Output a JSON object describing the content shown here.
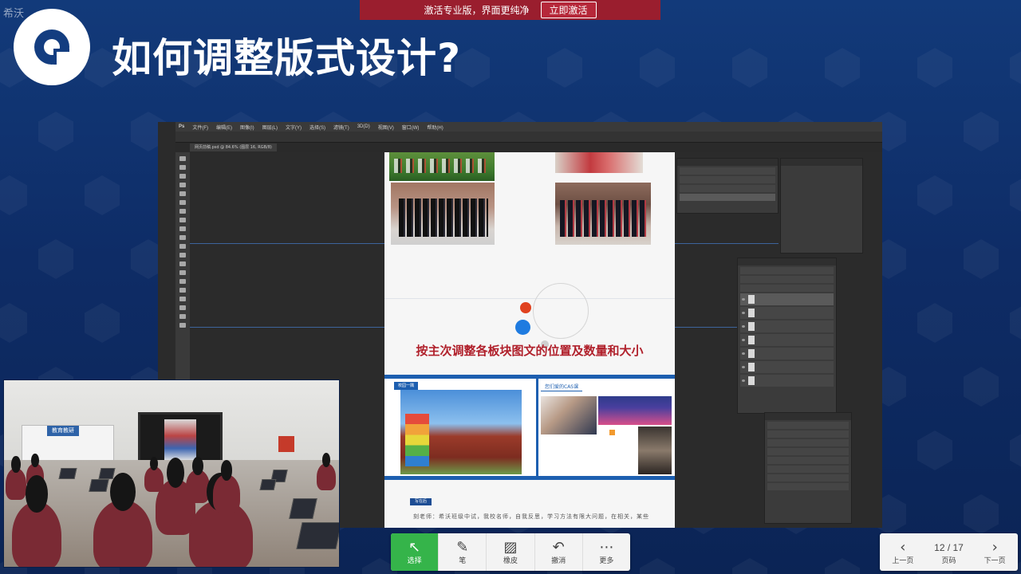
{
  "watermark": "希沃",
  "banner": {
    "text": "激活专业版，界面更纯净",
    "button": "立即激活"
  },
  "slide": {
    "title": "如何调整版式设计?"
  },
  "photoshop": {
    "logo": "Ps",
    "menu": [
      "文件(F)",
      "编辑(E)",
      "图像(I)",
      "图层(L)",
      "文字(Y)",
      "选择(S)",
      "滤镜(T)",
      "3D(D)",
      "视图(V)",
      "窗口(W)",
      "帮助(H)"
    ],
    "doc_tab": "网页前稿.psd @ 84.6% (图层 16, RGB/8)",
    "document": {
      "headline": "按主次调整各板块图文的位置及数量和大小",
      "section_label_1": "校园一隅",
      "section_label_2": "您们爱的CAS课",
      "section_label_3": "写在后",
      "footer_text": "刻老师：希沃班级中试，我校名师，自我反思，学习方法有限大问题，在相关，某些"
    }
  },
  "classroom": {
    "board_label": "教育教研"
  },
  "toolbar": {
    "items": [
      {
        "icon": "cursor-icon",
        "label": "选择",
        "active": true
      },
      {
        "icon": "pen-icon",
        "label": "笔",
        "active": false
      },
      {
        "icon": "eraser-icon",
        "label": "橡皮",
        "active": false
      },
      {
        "icon": "undo-icon",
        "label": "撤消",
        "active": false
      },
      {
        "icon": "more-icon",
        "label": "更多",
        "active": false
      }
    ]
  },
  "pager": {
    "prev_label": "上一页",
    "current": "12 / 17",
    "page_label": "页码",
    "next_label": "下一页"
  },
  "colors": {
    "background": "#0e2c66",
    "banner": "#9a1e2e",
    "headline": "#b0202b",
    "active_tool": "#35b44a",
    "section_blue": "#1d5fb0"
  }
}
